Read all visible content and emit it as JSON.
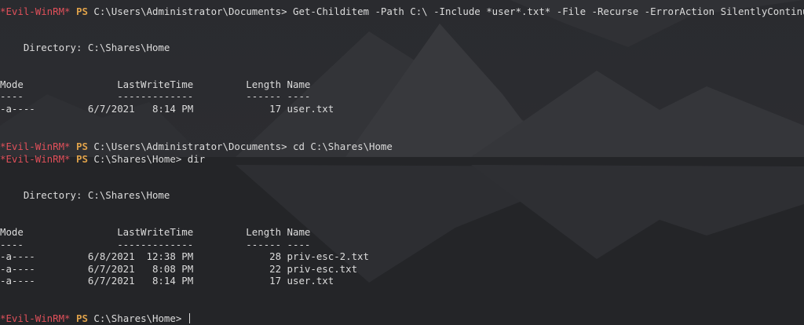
{
  "theme": {
    "prompt_color": "#e0505a",
    "ps_color": "#e0a24a",
    "text_color": "#dcdcdc",
    "background": "#26272b"
  },
  "prompt": {
    "tag": "*Evil-WinRM*",
    "ps": "PS"
  },
  "lines": {
    "cmd1_path": "C:\\Users\\Administrator\\Documents>",
    "cmd1_text": " Get-Childitem -Path C:\\ -Include *user*.txt* -File -Recurse -ErrorAction SilentlyContinue",
    "dir1": "    Directory: C:\\Shares\\Home",
    "hdr1": "Mode                LastWriteTime         Length Name",
    "sep1": "----                -------------         ------ ----",
    "row1": "-a----         6/7/2021   8:14 PM             17 user.txt",
    "cmd2_path": "C:\\Users\\Administrator\\Documents>",
    "cmd2_text": " cd C:\\Shares\\Home",
    "cmd3_path": "C:\\Shares\\Home>",
    "cmd3_text": " dir",
    "dir2": "    Directory: C:\\Shares\\Home",
    "hdr2": "Mode                LastWriteTime         Length Name",
    "sep2": "----                -------------         ------ ----",
    "row2a": "-a----         6/8/2021  12:38 PM             28 priv-esc-2.txt",
    "row2b": "-a----         6/7/2021   8:08 PM             22 priv-esc.txt",
    "row2c": "-a----         6/7/2021   8:14 PM             17 user.txt",
    "cmd4_path": "C:\\Shares\\Home>",
    "cmd4_text": " "
  }
}
